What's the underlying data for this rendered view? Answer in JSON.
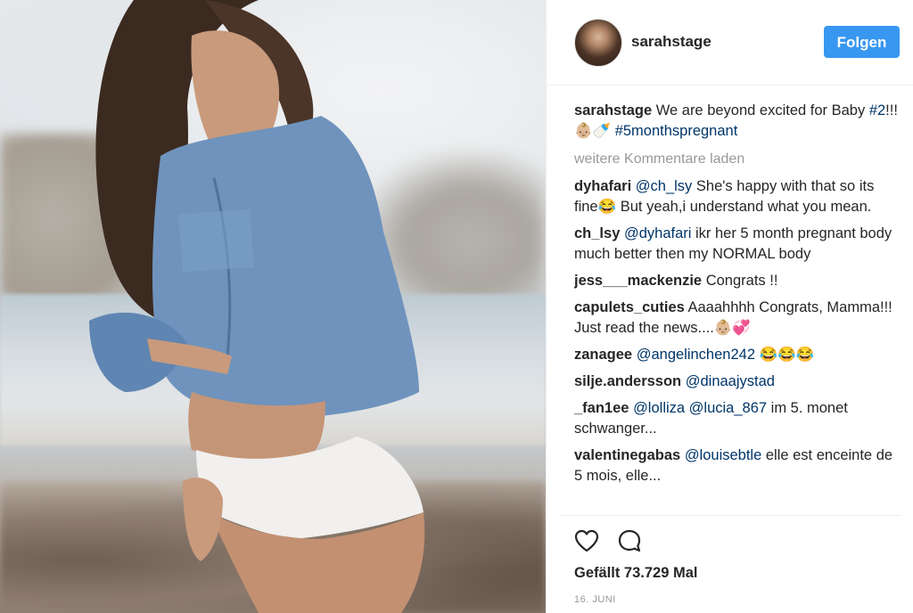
{
  "post": {
    "photo_alt": "Woman in denim shirt on beach",
    "header": {
      "username": "sarahstage",
      "follow_label": "Folgen"
    },
    "caption": {
      "user": "sarahstage",
      "text_before": " We are beyond excited for Baby ",
      "hashtag1": "#2",
      "text_mid": "!!! 👶🏼🍼 ",
      "hashtag2": "#5monthspregnant"
    },
    "load_more": "weitere Kommentare laden",
    "comments": [
      {
        "user": "dyhafari",
        "mention": "@ch_lsy",
        "text": " She's happy with that so its fine😂 But yeah,i understand what you mean."
      },
      {
        "user": "ch_lsy",
        "mention": "@dyhafari",
        "text": " ikr her 5 month pregnant body much better then my NORMAL body"
      },
      {
        "user": "jess___mackenzie",
        "mention": "",
        "text": " Congrats !!"
      },
      {
        "user": "capulets_cuties",
        "mention": "",
        "text": " Aaaahhhh Congrats, Mamma!!! Just read the news....👶🏼💞"
      },
      {
        "user": "zanagee",
        "mention": "@angelinchen242",
        "text": " 😂😂😂"
      },
      {
        "user": "silje.andersson",
        "mention": "@dinaajystad",
        "text": ""
      },
      {
        "user": "_fan1ee",
        "mention": "@lolliza @lucia_867",
        "text": " im 5. monet schwanger..."
      },
      {
        "user": "valentinegabas",
        "mention": "@louisebtle",
        "text": " elle est enceinte de 5 mois, elle..."
      }
    ],
    "actions": {
      "like_icon": "heart-outline-icon",
      "comment_icon": "speech-bubble-icon"
    },
    "likes": "Gefällt 73.729 Mal",
    "date": "16. JUNI"
  },
  "colors": {
    "follow_button": "#3897f0",
    "link": "#003569",
    "muted": "#999999",
    "text": "#262626"
  }
}
